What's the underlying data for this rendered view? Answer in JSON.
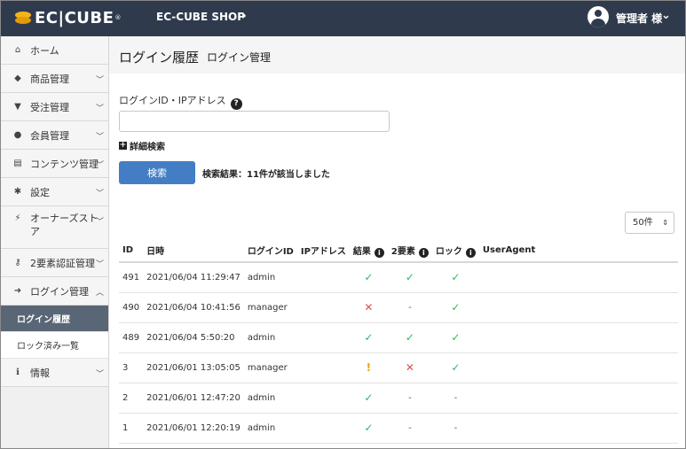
{
  "header": {
    "logo_text": "EC|CUBE",
    "logo_reg": "®",
    "shop_name": "EC-CUBE SHOP",
    "shop_chevron": "›",
    "user_name": "管理者 様",
    "user_chevron": "⌄"
  },
  "sidebar": {
    "items": [
      {
        "label": "ホーム",
        "icon": "home-icon",
        "glyph": "⌂"
      },
      {
        "label": "商品管理",
        "icon": "cube-icon",
        "glyph": "◆"
      },
      {
        "label": "受注管理",
        "icon": "cart-icon",
        "glyph": "▼"
      },
      {
        "label": "会員管理",
        "icon": "users-icon",
        "glyph": "●"
      },
      {
        "label": "コンテンツ管理",
        "icon": "file-icon",
        "glyph": "▤"
      },
      {
        "label": "設定",
        "icon": "gear-icon",
        "glyph": "✱"
      },
      {
        "label": "オーナーズストア",
        "icon": "plug-icon",
        "glyph": "⚡"
      },
      {
        "label": "2要素認証管理",
        "icon": "key-icon",
        "glyph": "⚷"
      },
      {
        "label": "ログイン管理",
        "icon": "sign-in-icon",
        "glyph": "➜"
      },
      {
        "label": "情報",
        "icon": "info-icon",
        "glyph": "ℹ"
      }
    ],
    "sub_items": [
      {
        "label": "ログイン履歴"
      },
      {
        "label": "ロック済み一覧"
      }
    ]
  },
  "main": {
    "title": "ログイン履歴",
    "subtitle": "ログイン管理",
    "field_label": "ログインID・IPアドレス",
    "field_value": "",
    "advanced_search": "詳細検索",
    "search_button": "検索",
    "result_text": "検索結果：11件が該当しました",
    "per_page": "50件"
  },
  "table": {
    "headers": [
      "ID",
      "日時",
      "ログインID",
      "IPアドレス",
      "結果",
      "2要素",
      "ロック",
      "UserAgent"
    ],
    "rows": [
      {
        "id": "491",
        "datetime": "2021/06/04 11:29:47",
        "login_id": "admin",
        "ip": "",
        "result": "success",
        "two_factor": "success",
        "lock": "success",
        "user_agent": ""
      },
      {
        "id": "490",
        "datetime": "2021/06/04 10:41:56",
        "login_id": "manager",
        "ip": "",
        "result": "failure",
        "two_factor": "-",
        "lock": "success",
        "user_agent": ""
      },
      {
        "id": "489",
        "datetime": "2021/06/04 5:50:20",
        "login_id": "admin",
        "ip": "",
        "result": "success",
        "two_factor": "success",
        "lock": "success",
        "user_agent": ""
      },
      {
        "id": "3",
        "datetime": "2021/06/01 13:05:05",
        "login_id": "manager",
        "ip": "",
        "result": "warning",
        "two_factor": "failure",
        "lock": "success",
        "user_agent": ""
      },
      {
        "id": "2",
        "datetime": "2021/06/01 12:47:20",
        "login_id": "admin",
        "ip": "",
        "result": "success",
        "two_factor": "-",
        "lock": "-",
        "user_agent": ""
      },
      {
        "id": "1",
        "datetime": "2021/06/01 12:20:19",
        "login_id": "admin",
        "ip": "",
        "result": "success",
        "two_factor": "-",
        "lock": "-",
        "user_agent": ""
      }
    ]
  },
  "status_glyphs": {
    "success": "✓",
    "failure": "✕",
    "warning": "!",
    "-": "-"
  },
  "colors": {
    "header_bg": "#2f3b4d",
    "primary": "#437ec4",
    "success": "#2eb85c",
    "danger": "#d9534f",
    "warning": "#f0a30a",
    "active_nav": "#596676"
  }
}
